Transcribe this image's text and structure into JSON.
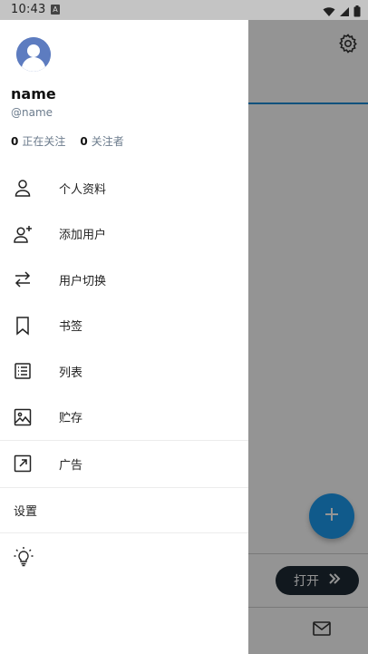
{
  "status_bar": {
    "time": "10:43",
    "notification_badge": "A",
    "icons": [
      "wifi-icon",
      "signal-icon",
      "battery-icon"
    ]
  },
  "background": {
    "open_button_label": "打开",
    "fab_icon": "plus-icon",
    "settings_icon": "gear-icon",
    "mail_icon": "mail-icon",
    "accent_color": "#1d9bf0"
  },
  "drawer": {
    "profile": {
      "name": "name",
      "handle": "@name",
      "following_count": "0",
      "following_label": "正在关注",
      "followers_count": "0",
      "followers_label": "关注者"
    },
    "items": [
      {
        "icon": "person-icon",
        "label": "个人资料"
      },
      {
        "icon": "add-user-icon",
        "label": "添加用户"
      },
      {
        "icon": "switch-arrows-icon",
        "label": "用户切换"
      },
      {
        "icon": "bookmark-icon",
        "label": "书签"
      },
      {
        "icon": "list-icon",
        "label": "列表"
      },
      {
        "icon": "image-icon",
        "label": "贮存"
      },
      {
        "icon": "external-link-icon",
        "label": "广告"
      }
    ],
    "settings_label": "设置",
    "theme_icon": "lightbulb-icon"
  }
}
